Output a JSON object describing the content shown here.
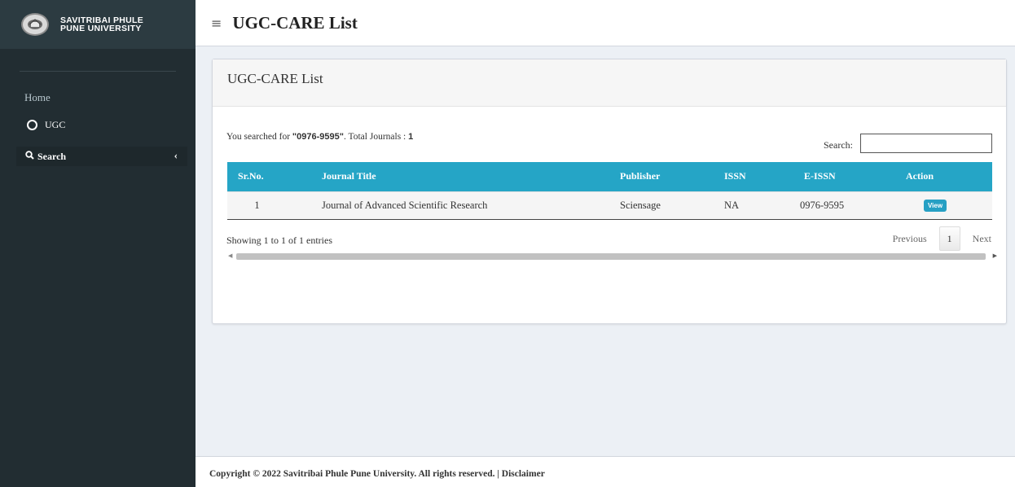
{
  "sidebar": {
    "brand_line1": "SAVITRIBAI PHULE",
    "brand_line2": "PUNE UNIVERSITY",
    "home_label": "Home",
    "ugc_label": "UGC",
    "search_label": "Search",
    "search_chevron": "‹"
  },
  "header": {
    "menu_icon": "≡",
    "title": "UGC-CARE List"
  },
  "box": {
    "title": "UGC-CARE List",
    "summary_prefix": "You searched for ",
    "summary_query": "\"0976-9595\"",
    "summary_middle": ". Total Journals : ",
    "summary_total": "1",
    "search_label": "Search:",
    "search_value": ""
  },
  "table": {
    "headers": [
      "Sr.No.",
      "Journal Title",
      "Publisher",
      "ISSN",
      "E-ISSN",
      "Action"
    ],
    "rows": [
      {
        "sr": "1",
        "title": "Journal of Advanced Scientific Research",
        "publisher": "Sciensage",
        "issn": "NA",
        "eissn": "0976-9595",
        "action": "View"
      }
    ]
  },
  "pagination": {
    "info": "Showing 1 to 1 of 1 entries",
    "previous": "Previous",
    "current_page": "1",
    "next": "Next"
  },
  "footer": {
    "text": "Copyright © 2022 Savitribai Phule Pune University. All rights reserved. | Disclaimer"
  },
  "colors": {
    "sidebar_bg": "#222d32",
    "table_header": "#25a5c6",
    "view_button": "#26a0c4"
  }
}
